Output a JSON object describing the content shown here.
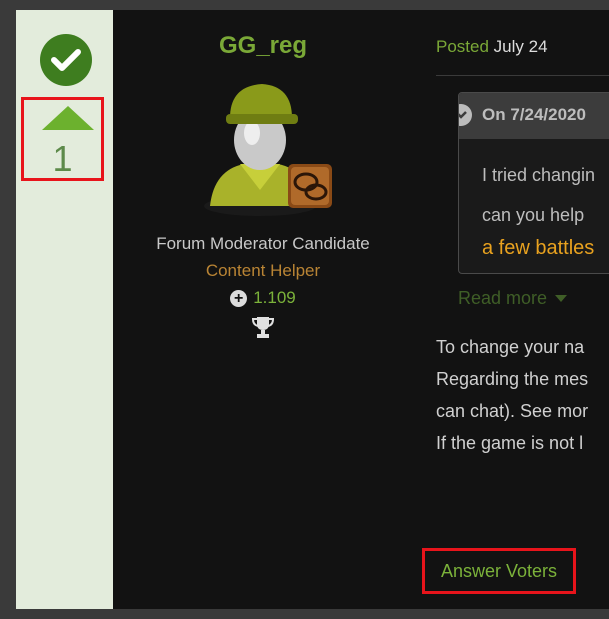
{
  "vote": {
    "count": "1"
  },
  "author": {
    "name": "GG_reg",
    "rank": "Forum Moderator Candidate",
    "role": "Content Helper",
    "reputation": "1.109"
  },
  "post": {
    "posted_label": "Posted",
    "posted_date": "July 24",
    "quote": {
      "cite": "On 7/24/2020",
      "line1": "I tried changin",
      "line2": "can you help",
      "line3": "a few battles"
    },
    "read_more": "Read more",
    "body": [
      "To change your na",
      "Regarding the mes",
      "can chat). See mor",
      "If the game is not l"
    ],
    "answer_voters": "Answer Voters"
  },
  "colors": {
    "accent_green": "#7aa837",
    "highlight_red": "#e8141b",
    "role_orange": "#b98434",
    "quote_orange": "#e9a21f"
  }
}
